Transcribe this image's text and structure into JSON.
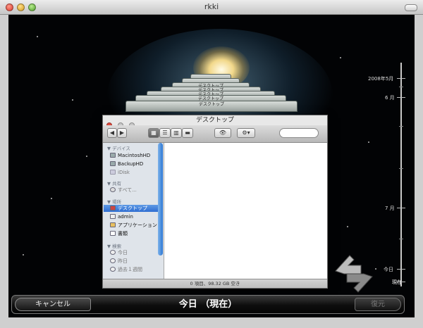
{
  "window": {
    "title": "rkki"
  },
  "stack": {
    "label": "デスクトップ"
  },
  "finder": {
    "title": "デスクトップ",
    "search_placeholder": "",
    "sidebar": {
      "devices_header": "▼ デバイス",
      "devices": [
        "MacintoshHD",
        "BackupHD",
        "iDisk"
      ],
      "shared_header": "▼ 共有",
      "shared": [
        "すべて..."
      ],
      "places_header": "▼ 場所",
      "places": [
        "デスクトップ",
        "admin",
        "アプリケーション",
        "書類"
      ],
      "search_header": "▼ 検索",
      "search_for": [
        "今日",
        "昨日",
        "過去１週間"
      ]
    },
    "status": "0 項目、98.32 GB 空き"
  },
  "timeline": {
    "labels": [
      "2008年5月",
      "6 月",
      "7 月",
      "今日",
      "現在"
    ]
  },
  "bottom": {
    "cancel": "キャンセル",
    "center": "今日 （現在）",
    "restore": "復元"
  },
  "colors": {
    "selection": "#2f6ed2",
    "background": "#020305"
  }
}
